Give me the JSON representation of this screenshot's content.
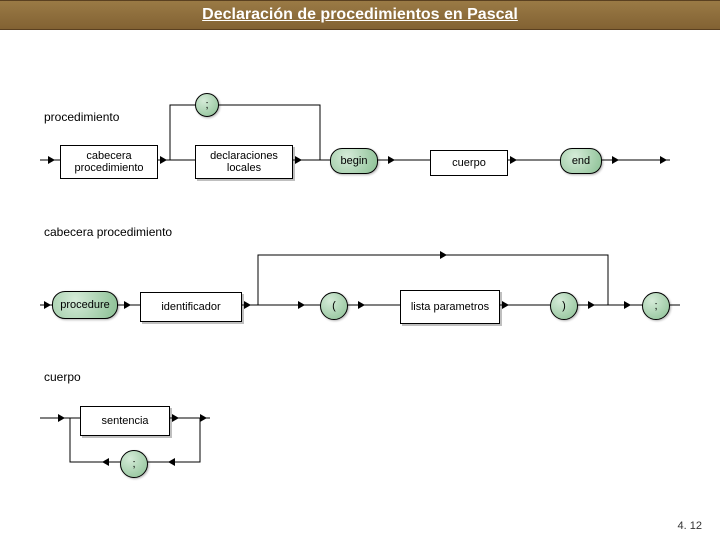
{
  "title": "Declaración de procedimientos en Pascal",
  "section1": {
    "label": "procedimiento",
    "box1": "cabecera procedimiento",
    "box2": "declaraciones locales",
    "term_begin": "begin",
    "box_cuerpo": "cuerpo",
    "term_end": "end",
    "loop_semicolon": ";"
  },
  "section2": {
    "label": "cabecera procedimiento",
    "term_procedure": "procedure",
    "box_ident": "identificador",
    "term_lparen": "(",
    "box_lista": "lista parametros",
    "term_rparen": ")",
    "term_semi": ";"
  },
  "section3": {
    "label": "cuerpo",
    "box_sentencia": "sentencia",
    "term_semi": ";"
  },
  "page_num": "4. 12"
}
